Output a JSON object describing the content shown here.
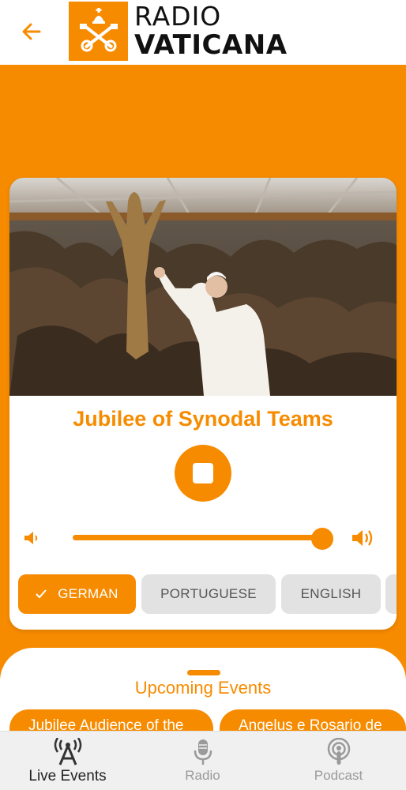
{
  "header": {
    "logo_line1": "RADIO",
    "logo_line2": "VATICANA",
    "back_icon": "arrow-left-icon"
  },
  "player": {
    "event_title": "Jubilee of Synodal Teams",
    "state": "playing",
    "volume_percent": 100,
    "languages": [
      {
        "label": "GERMAN",
        "selected": true
      },
      {
        "label": "PORTUGUESE",
        "selected": false
      },
      {
        "label": "ENGLISH",
        "selected": false
      }
    ]
  },
  "upcoming": {
    "title": "Upcoming Events",
    "events": [
      {
        "label": "Jubilee Audience of the"
      },
      {
        "label": "Angelus e Rosario de"
      }
    ]
  },
  "tabs": [
    {
      "label": "Live Events",
      "icon": "live-broadcast-icon",
      "active": true
    },
    {
      "label": "Radio",
      "icon": "microphone-icon",
      "active": false
    },
    {
      "label": "Podcast",
      "icon": "podcast-icon",
      "active": false
    }
  ],
  "colors": {
    "accent": "#F78B00",
    "chip_inactive": "#e2e2e2",
    "tabbar": "#f0f0f0"
  }
}
